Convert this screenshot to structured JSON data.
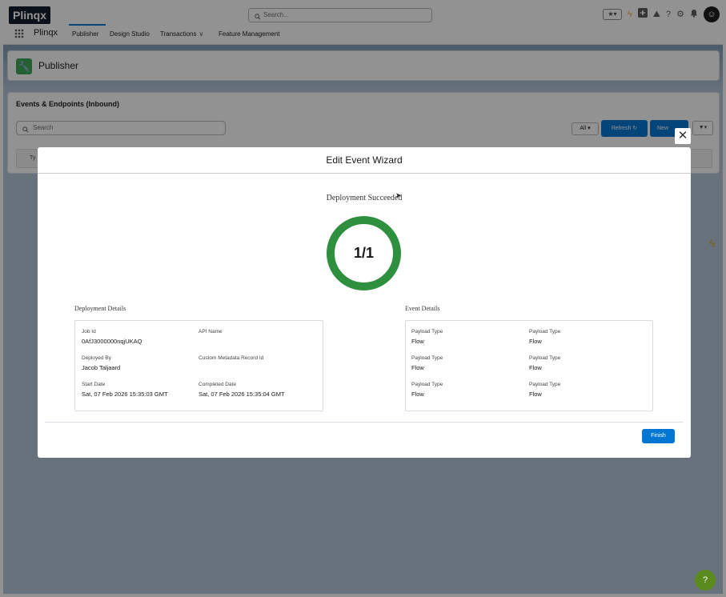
{
  "app": {
    "logo": "Plinqx",
    "name": "Plinqx",
    "search_placeholder": "Search...",
    "header_icons": [
      "favorites-icon",
      "bolt-icon",
      "add-icon",
      "trailhead-icon",
      "help-icon",
      "setup-gear-icon",
      "notifications-bell-icon",
      "avatar"
    ]
  },
  "nav": {
    "items": [
      {
        "label": "Publisher",
        "active": true
      },
      {
        "label": "Design Studio"
      },
      {
        "label": "Transactions",
        "has_dropdown": true
      },
      {
        "label": "Feature Management"
      }
    ]
  },
  "page": {
    "title": "Publisher",
    "list_title": "Events & Endpoints (Inbound)",
    "search_placeholder": "Search",
    "filter_all": "All",
    "refresh_label": "Refresh",
    "new_label": "New",
    "col_header": "Ty"
  },
  "modal": {
    "title": "Edit Event Wizard",
    "status_title": "Deployment Succeeded",
    "progress_text": "1/1",
    "progress_fraction": 1.0,
    "deployment_section": "Deployment Details",
    "event_section": "Event Details",
    "deployment_fields": [
      {
        "label": "Job Id",
        "value": "0AfJ3000000nqjUKAQ"
      },
      {
        "label": "API Name",
        "value": ""
      },
      {
        "label": "Deployed By",
        "value": "Jacob Taljaard"
      },
      {
        "label": "Custom Metadata Record Id",
        "value": ""
      },
      {
        "label": "Start Date",
        "value": "Sat, 07 Feb 2026 15:35:03 GMT"
      },
      {
        "label": "Completed Date",
        "value": "Sat, 07 Feb 2026 15:35:04 GMT"
      }
    ],
    "event_fields": [
      {
        "label": "Payload Type",
        "value": "Flow"
      },
      {
        "label": "Payload Type",
        "value": "Flow"
      },
      {
        "label": "Payload Type",
        "value": "Flow"
      },
      {
        "label": "Payload Type",
        "value": "Flow"
      },
      {
        "label": "Payload Type",
        "value": "Flow"
      },
      {
        "label": "Payload Type",
        "value": "Flow"
      }
    ],
    "finish_label": "Finish"
  },
  "colors": {
    "brand_blue": "#0176d3",
    "success_green": "#2e8f3f"
  }
}
